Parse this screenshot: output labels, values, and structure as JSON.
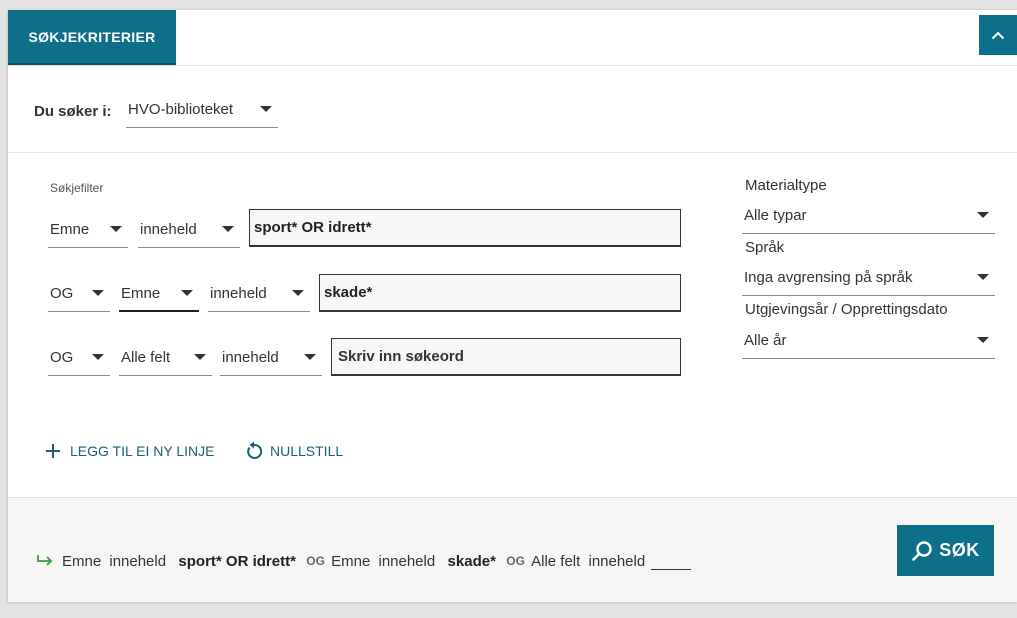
{
  "tabs": {
    "active_label": "SØKJEKRITERIER"
  },
  "scope": {
    "label": "Du søker i:",
    "value": "HVO-biblioteket"
  },
  "filter": {
    "section_label": "Søkjefilter",
    "rows": [
      {
        "field": "Emne",
        "condition": "inneheld",
        "value": "sport* OR idrett*"
      },
      {
        "operator": "OG",
        "field": "Emne",
        "condition": "inneheld",
        "value": "skade*"
      },
      {
        "operator": "OG",
        "field": "Alle felt",
        "condition": "inneheld",
        "placeholder": "Skriv inn søkeord"
      }
    ],
    "add_line_label": "LEGG TIL EI NY LINJE",
    "reset_label": "NULLSTILL"
  },
  "facets": {
    "material": {
      "label": "Materialtype",
      "value": "Alle typar"
    },
    "language": {
      "label": "Språk",
      "value": "Inga avgrensing på språk"
    },
    "year": {
      "label": "Utgjevingsår / Opprettingsdato",
      "value": "Alle år"
    }
  },
  "query_summary": {
    "r1_field": "Emne",
    "r1_cond": "inneheld",
    "r1_value": "sport* OR idrett*",
    "op1": "OG",
    "r2_field": "Emne",
    "r2_cond": "inneheld",
    "r2_value": "skade*",
    "op2": "OG",
    "r3_field": "Alle felt",
    "r3_cond": "inneheld"
  },
  "search_button_label": "SØK",
  "colors": {
    "accent": "#0e7088",
    "arrow": "#3c9a3c",
    "link": "#1a5f74"
  }
}
